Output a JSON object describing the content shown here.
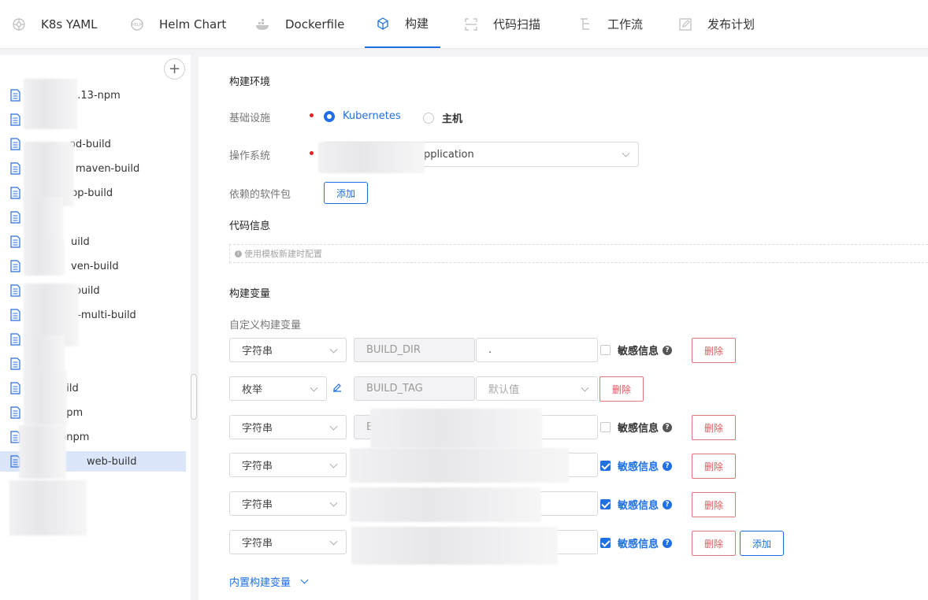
{
  "tabs": [
    {
      "label": "K8s YAML",
      "icon": "helm-wheel-icon"
    },
    {
      "label": "Helm Chart",
      "icon": "helm-icon"
    },
    {
      "label": "Dockerfile",
      "icon": "docker-icon"
    },
    {
      "label": "构建",
      "icon": "cube-icon",
      "active": true
    },
    {
      "label": "代码扫描",
      "icon": "scan-icon"
    },
    {
      "label": "工作流",
      "icon": "workflow-icon"
    },
    {
      "label": "发布计划",
      "icon": "edit-plan-icon"
    }
  ],
  "sidebar": {
    "add_label": "+",
    "items": [
      {
        "label": "1.13-npm"
      },
      {
        "label": ""
      },
      {
        "label": "od-build"
      },
      {
        "label": "maven-build"
      },
      {
        "label": "pp-build"
      },
      {
        "label": ""
      },
      {
        "label": "uild"
      },
      {
        "label": "ven-build"
      },
      {
        "label": "-build"
      },
      {
        "label": "n-multi-build"
      },
      {
        "label": ""
      },
      {
        "label": ""
      },
      {
        "label": "uild"
      },
      {
        "label": "npm"
      },
      {
        "label": "pnpm"
      },
      {
        "label": "web-build",
        "selected": true
      }
    ]
  },
  "main": {
    "build_env_title": "构建环境",
    "infra_label": "基础设施",
    "infra_options": [
      {
        "label": "Kubernetes",
        "selected": true
      },
      {
        "label": "主机",
        "selected": false
      }
    ],
    "os_label": "操作系统",
    "os_value": "pplication",
    "deps_label": "依赖的软件包",
    "deps_add": "添加",
    "code_info_title": "代码信息",
    "code_info_hint": "使用模板新建时配置",
    "build_vars_title": "构建变量",
    "custom_vars_label": "自定义构建变量",
    "vars": [
      {
        "type": "字符串",
        "key": "BUILD_DIR",
        "value": ".",
        "sensitive": false,
        "sensitive_label": "敏感信息",
        "delete": "删除"
      },
      {
        "type": "枚举",
        "key": "BUILD_TAG",
        "value_placeholder": "默认值",
        "delete": "删除"
      },
      {
        "type": "字符串",
        "key": "B",
        "value": "",
        "sensitive": false,
        "sensitive_label": "敏感信息",
        "delete": "删除"
      },
      {
        "type": "字符串",
        "key": "",
        "value": "",
        "sensitive": true,
        "sensitive_label": "敏感信息",
        "delete": "删除"
      },
      {
        "type": "字符串",
        "key": "",
        "value": "",
        "sensitive": true,
        "sensitive_label": "敏感信息",
        "delete": "删除"
      },
      {
        "type": "字符串",
        "key": "",
        "value": "",
        "sensitive": true,
        "sensitive_label": "敏感信息",
        "delete": "删除",
        "add": "添加"
      }
    ],
    "builtin_vars_link": "内置构建变量"
  }
}
